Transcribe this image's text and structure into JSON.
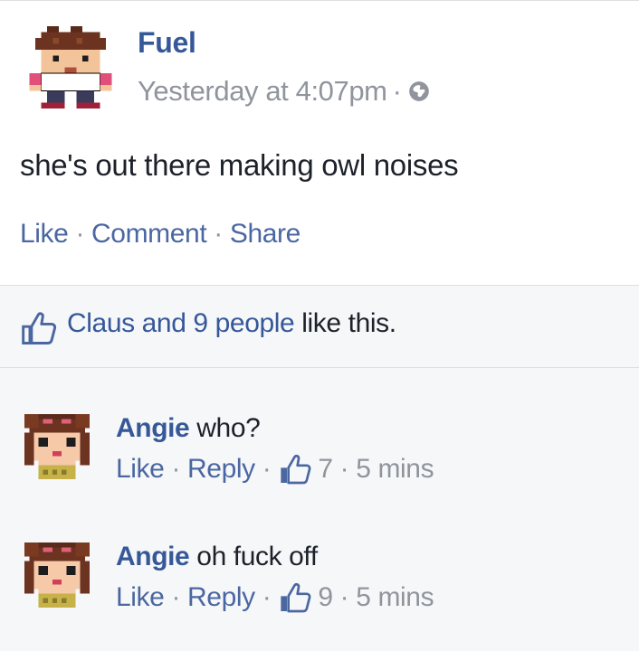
{
  "post": {
    "author": "Fuel",
    "timestamp": "Yesterday at 4:07pm",
    "meta_separator": "·",
    "privacy_icon": "globe-icon",
    "text": "she's out there making owl noises",
    "actions": {
      "like": "Like",
      "comment": "Comment",
      "share": "Share",
      "separator": "·"
    }
  },
  "likes": {
    "names": "Claus and 9 people",
    "suffix": " like this.",
    "icon": "thumbs-up-icon"
  },
  "comments": [
    {
      "author": "Angie",
      "text": " who?",
      "like": "Like",
      "reply": "Reply",
      "reactions": "7",
      "time": "5 mins",
      "separator": "·"
    },
    {
      "author": "Angie",
      "text": " oh fuck off",
      "like": "Like",
      "reply": "Reply",
      "reactions": "9",
      "time": "5 mins",
      "separator": "·"
    }
  ],
  "colors": {
    "link": "#365899",
    "action": "#4b67a1",
    "muted": "#90949c",
    "text": "#1d2129",
    "background": "#f6f7f9"
  }
}
